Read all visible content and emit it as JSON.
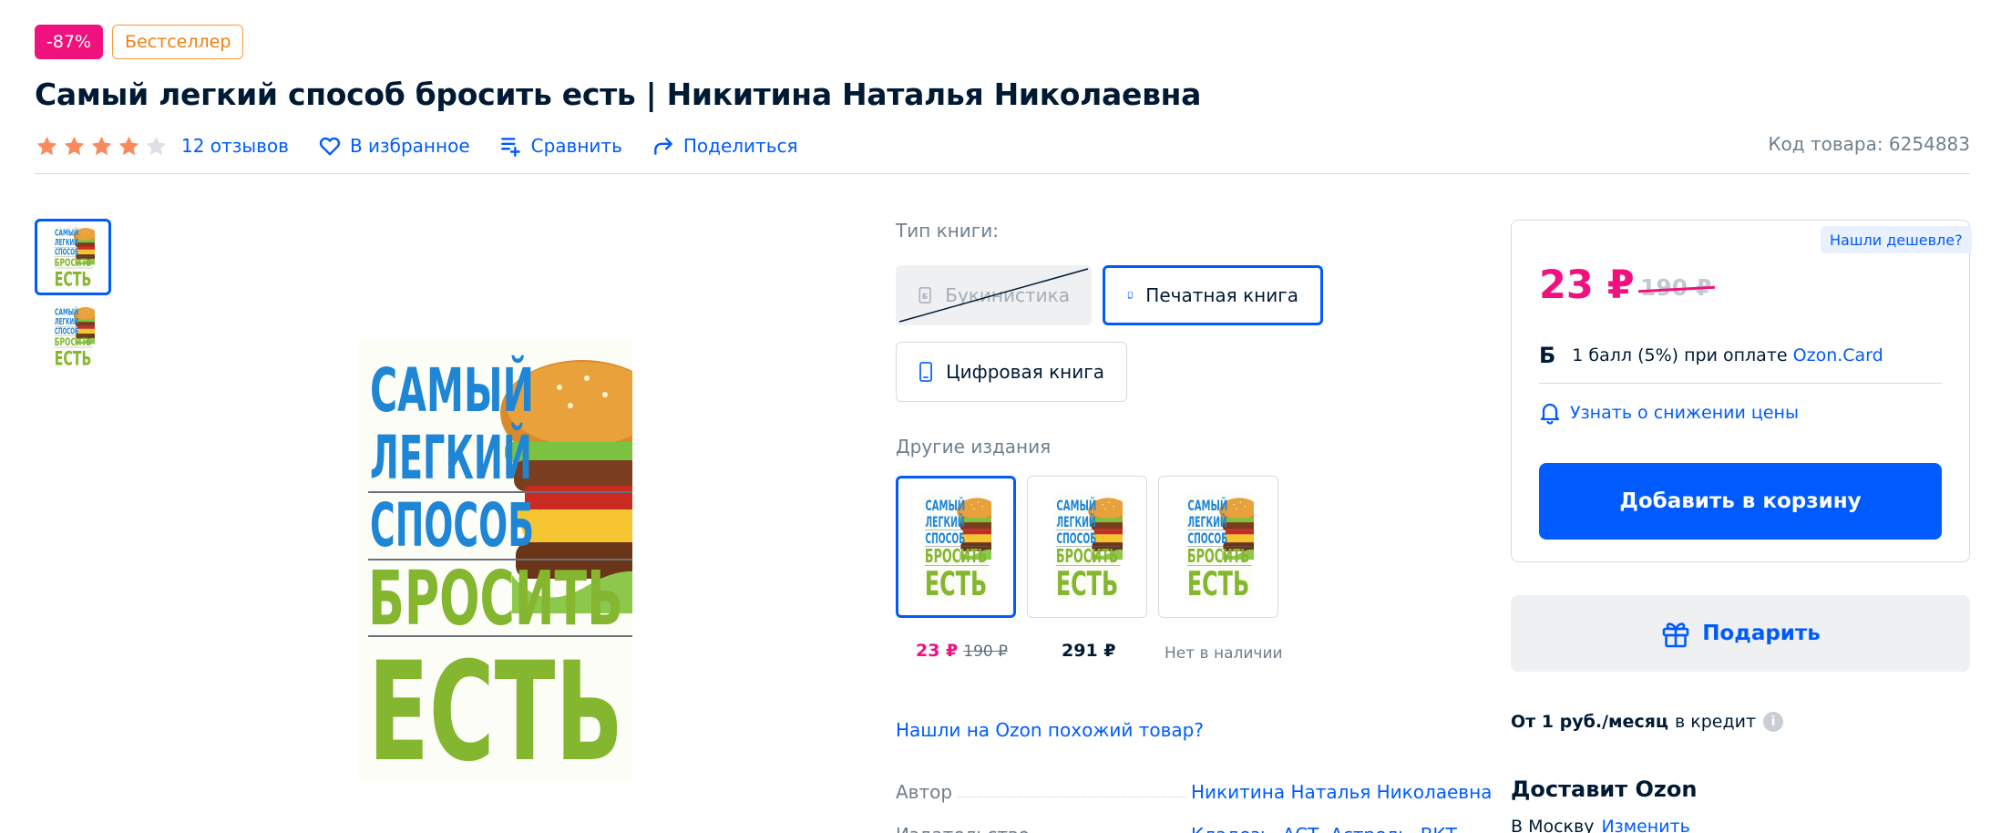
{
  "badges": {
    "discount": "-87%",
    "bestseller": "Бестселлер"
  },
  "product": {
    "title": "Самый легкий способ бросить есть | Никитина Наталья Николаевна",
    "rating": 4,
    "rating_max": 5,
    "reviews_label": "12 отзывов",
    "favorite_label": "В избранное",
    "compare_label": "Сравнить",
    "share_label": "Поделиться",
    "sku_label": "Код товара: 6254883"
  },
  "cover": {
    "lines": [
      "САМЫЙ",
      "ЛЕГКИЙ",
      "СПОСОБ",
      "БРОСИТЬ",
      "ЕСТЬ"
    ]
  },
  "book_type": {
    "label": "Тип книги:",
    "options": [
      {
        "label": "Букинистика",
        "icon": "book-b-icon",
        "state": "disabled"
      },
      {
        "label": "Печатная книга",
        "icon": "book-icon",
        "state": "selected"
      },
      {
        "label": "Цифровая книга",
        "icon": "tablet-icon",
        "state": "normal"
      }
    ]
  },
  "editions": {
    "label": "Другие издания",
    "items": [
      {
        "price": "23 ₽",
        "old_price": "190 ₽"
      },
      {
        "price": "291 ₽"
      },
      {
        "status": "Нет в наличии"
      }
    ]
  },
  "similar_link": "Нашли на Ozon похожий товар?",
  "specs": [
    {
      "key": "Автор",
      "value": "Никитина Наталья Николаевна"
    },
    {
      "key": "Издательство",
      "value": "Кладезь, АСТ, Астрель, ВКТ"
    }
  ],
  "buy": {
    "found_cheaper": "Нашли дешевле?",
    "price": "23 ₽",
    "old_price": "190 ₽",
    "points_icon": "Б",
    "points_text": "1 балл (5%) при оплате",
    "points_link": "Ozon.Card",
    "notify_label": "Узнать о снижении цены",
    "cart_label": "Добавить в корзину",
    "gift_label": "Подарить",
    "credit_bold": "От 1 руб./месяц",
    "credit_text": "в кредит",
    "delivery_title": "Доставит Ozon",
    "delivery_city": "В Москву",
    "delivery_change": "Изменить"
  },
  "colors": {
    "accent": "#005bff",
    "price": "#f1117e",
    "star": "#f98a5e",
    "bestseller": "#f07d12"
  }
}
